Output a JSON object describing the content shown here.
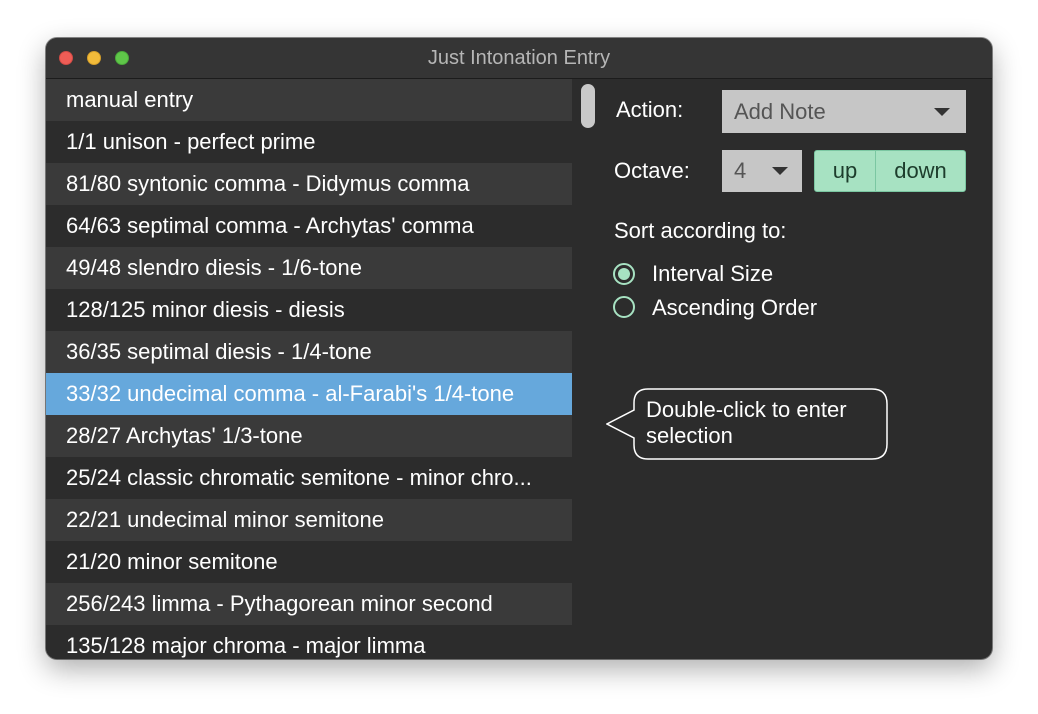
{
  "window": {
    "title": "Just Intonation Entry"
  },
  "intervals": [
    "manual entry",
    "1/1 unison - perfect prime",
    "81/80 syntonic comma - Didymus comma",
    "64/63 septimal comma - Archytas' comma",
    "49/48 slendro diesis - 1/6-tone",
    "128/125 minor diesis - diesis",
    "36/35 septimal diesis - 1/4-tone",
    "33/32 undecimal comma - al-Farabi's 1/4-tone",
    "28/27 Archytas' 1/3-tone",
    "25/24 classic chromatic semitone - minor chro...",
    "22/21 undecimal minor semitone",
    "21/20 minor semitone",
    "256/243 limma - Pythagorean minor second",
    "135/128 major chroma - major limma"
  ],
  "selected_index": 7,
  "action": {
    "label": "Action:",
    "value": "Add Note"
  },
  "octave": {
    "label": "Octave:",
    "value": "4",
    "up_label": "up",
    "down_label": "down"
  },
  "sort": {
    "label": "Sort according to:",
    "options": [
      {
        "label": "Interval Size",
        "checked": true
      },
      {
        "label": "Ascending Order",
        "checked": false
      }
    ]
  },
  "tooltip": {
    "text": "Double-click to enter selection"
  },
  "colors": {
    "background": "#2c2c2c",
    "row_alt": "#3a3a3a",
    "selection": "#66a8dc",
    "accent": "#a7e2c2"
  }
}
